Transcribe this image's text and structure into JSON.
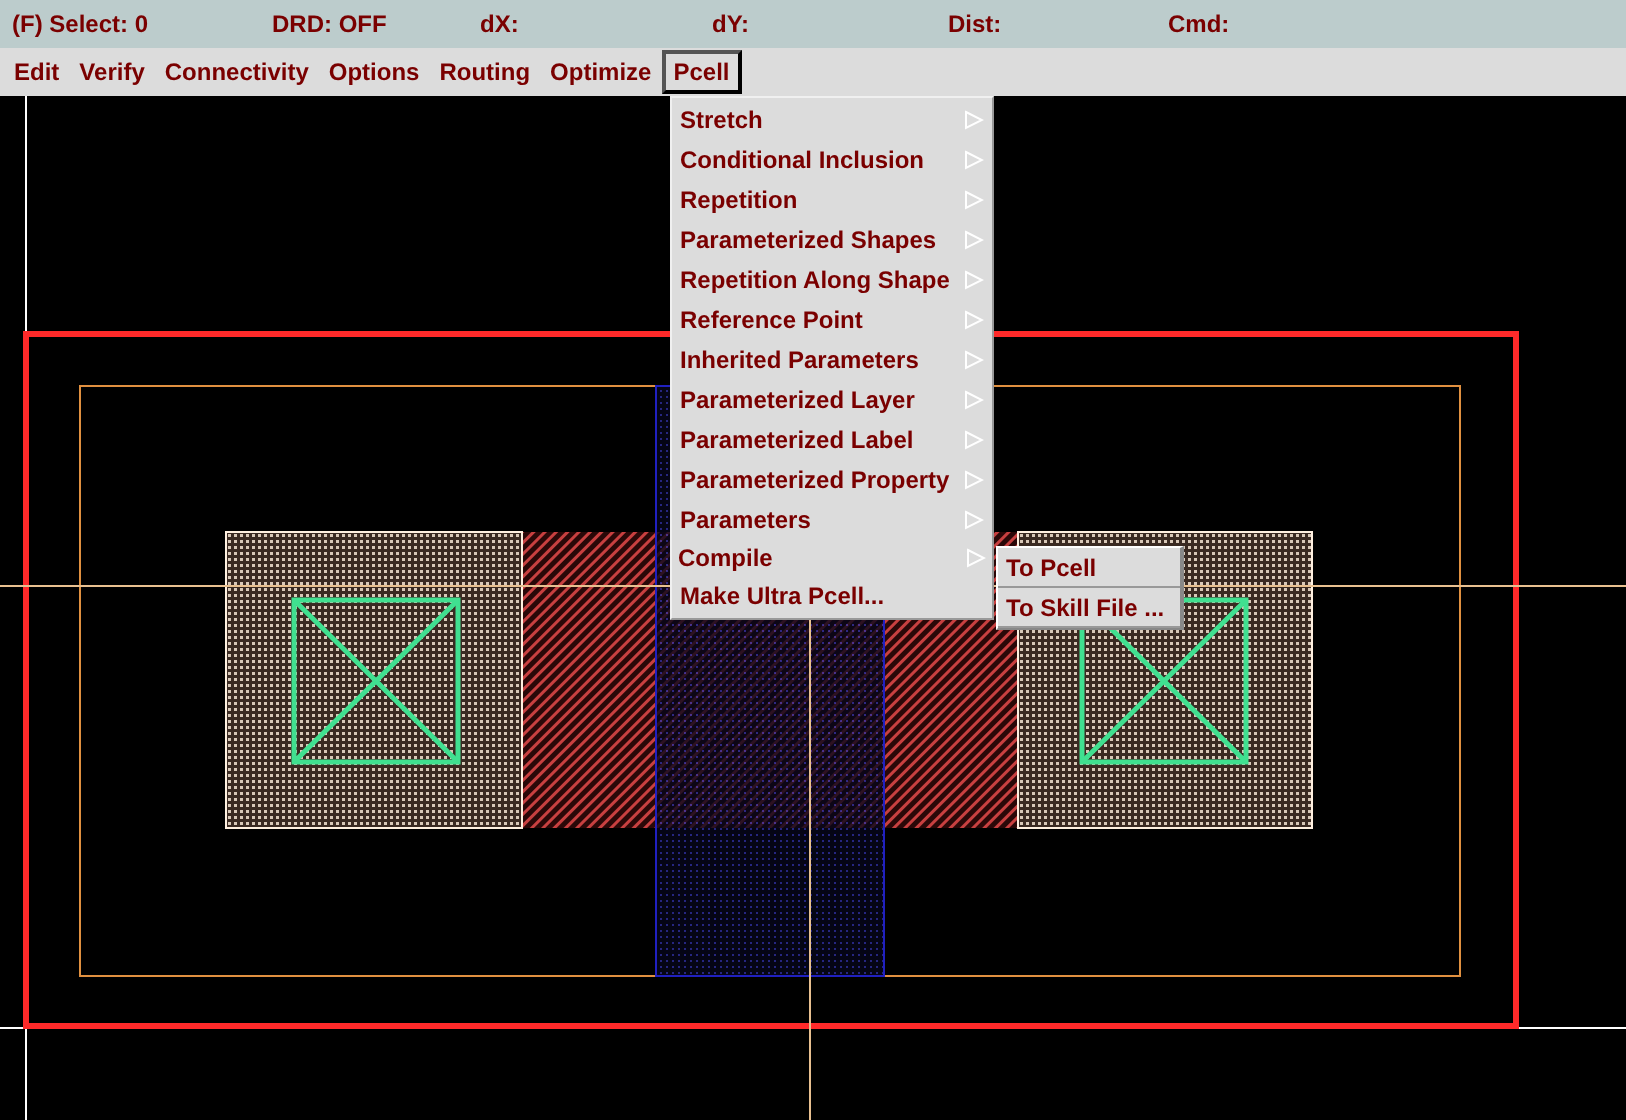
{
  "status_bar": [
    {
      "label": "(F) Select: 0"
    },
    {
      "label": "DRD: OFF"
    },
    {
      "label": "dX:"
    },
    {
      "label": "dY:"
    },
    {
      "label": "Dist:"
    },
    {
      "label": "Cmd:"
    }
  ],
  "menu_bar": [
    {
      "label": "Edit",
      "selected": false
    },
    {
      "label": "Verify",
      "selected": false
    },
    {
      "label": "Connectivity",
      "selected": false
    },
    {
      "label": "Options",
      "selected": false
    },
    {
      "label": "Routing",
      "selected": false
    },
    {
      "label": "Optimize",
      "selected": false
    },
    {
      "label": "Pcell",
      "selected": true
    }
  ],
  "pcell_menu": [
    {
      "label": "Stretch",
      "kind": "submenu",
      "selected": false
    },
    {
      "label": "Conditional Inclusion",
      "kind": "submenu",
      "selected": false
    },
    {
      "label": "Repetition",
      "kind": "submenu",
      "selected": false
    },
    {
      "label": "Parameterized Shapes",
      "kind": "submenu",
      "selected": false
    },
    {
      "label": "Repetition Along Shape",
      "kind": "submenu",
      "selected": false
    },
    {
      "label": "Reference Point",
      "kind": "submenu",
      "selected": false
    },
    {
      "label": "Inherited Parameters",
      "kind": "submenu",
      "selected": false
    },
    {
      "label": "Parameterized Layer",
      "kind": "submenu",
      "selected": false
    },
    {
      "label": "Parameterized Label",
      "kind": "submenu",
      "selected": false
    },
    {
      "label": "Parameterized Property",
      "kind": "submenu",
      "selected": false
    },
    {
      "label": "Parameters",
      "kind": "submenu",
      "selected": false
    },
    {
      "label": "Compile",
      "kind": "submenu",
      "selected": true
    },
    {
      "label": "Make Ultra Pcell...",
      "kind": "action",
      "selected": false
    }
  ],
  "compile_submenu": [
    {
      "label": "To Pcell"
    },
    {
      "label": "To Skill File ..."
    }
  ]
}
